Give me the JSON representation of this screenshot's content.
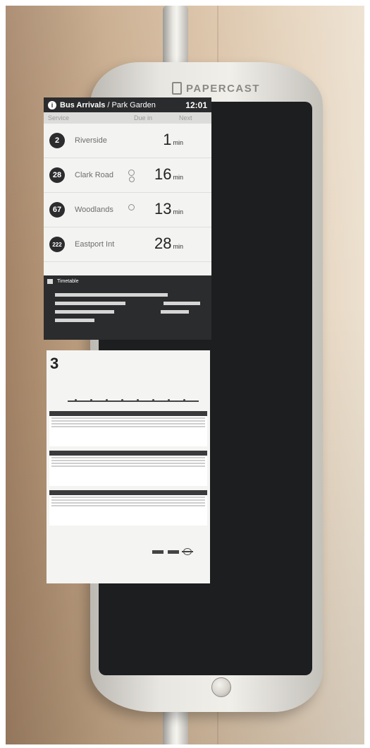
{
  "device": {
    "brand": "PAPERCAST"
  },
  "arrivals": {
    "title": "Bus Arrivals",
    "separator": "/",
    "stop": "Park Garden",
    "time": "12:01",
    "columns": {
      "service": "Service",
      "due": "Due in",
      "next": "Next"
    },
    "rows": [
      {
        "route": "2",
        "destination": "Riverside",
        "due": "1",
        "unit": "min",
        "live": "none"
      },
      {
        "route": "28",
        "destination": "Clark Road",
        "due": "16",
        "unit": "min",
        "live": "double"
      },
      {
        "route": "67",
        "destination": "Woodlands",
        "due": "13",
        "unit": "min",
        "live": "single"
      },
      {
        "route": "222",
        "destination": "Eastport Int",
        "due": "28",
        "unit": "min",
        "live": "none"
      }
    ]
  },
  "timetable": {
    "title": "Timetable"
  },
  "schedule_poster": {
    "route": "3"
  }
}
